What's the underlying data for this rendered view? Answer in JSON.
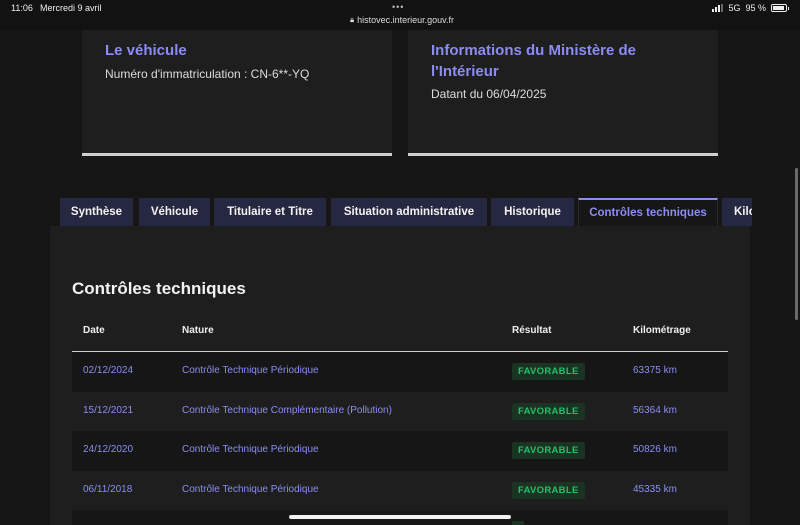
{
  "status_bar": {
    "time": "11:06",
    "date": "Mercredi 9 avril",
    "url": "histovec.interieur.gouv.fr",
    "network": "5G",
    "battery": "95 %",
    "battery_level": 0.95
  },
  "vehicle_card": {
    "title": "Le véhicule",
    "plate_text": "Numéro d'immatriculation : CN-6**-YQ"
  },
  "ministry_card": {
    "title": "Informations du Ministère de l'Intérieur",
    "date_text": "Datant du 06/04/2025"
  },
  "tabs": [
    {
      "label": "Synthèse",
      "active": false
    },
    {
      "label": "Véhicule",
      "active": false
    },
    {
      "label": "Titulaire et Titre",
      "active": false
    },
    {
      "label": "Situation administrative",
      "active": false
    },
    {
      "label": "Historique",
      "active": false
    },
    {
      "label": "Contrôles techniques",
      "active": true
    },
    {
      "label": "Kilo",
      "active": false
    }
  ],
  "section": {
    "title": "Contrôles techniques",
    "columns": [
      "Date",
      "Nature",
      "Résultat",
      "Kilométrage"
    ]
  },
  "rows": [
    {
      "date": "02/12/2024",
      "nature": "Contrôle Technique Périodique",
      "result": "FAVORABLE",
      "km": "63375 km"
    },
    {
      "date": "15/12/2021",
      "nature": "Contrôle Technique Complémentaire (Pollution)",
      "result": "FAVORABLE",
      "km": "56364 km"
    },
    {
      "date": "24/12/2020",
      "nature": "Contrôle Technique Périodique",
      "result": "FAVORABLE",
      "km": "50826 km"
    },
    {
      "date": "06/11/2018",
      "nature": "Contrôle Technique Périodique",
      "result": "FAVORABLE",
      "km": "45335 km"
    }
  ],
  "colors": {
    "accent": "#8c8cf5",
    "tab_bg": "#262842",
    "success": "#22c068",
    "success_bg": "#1b3323"
  }
}
